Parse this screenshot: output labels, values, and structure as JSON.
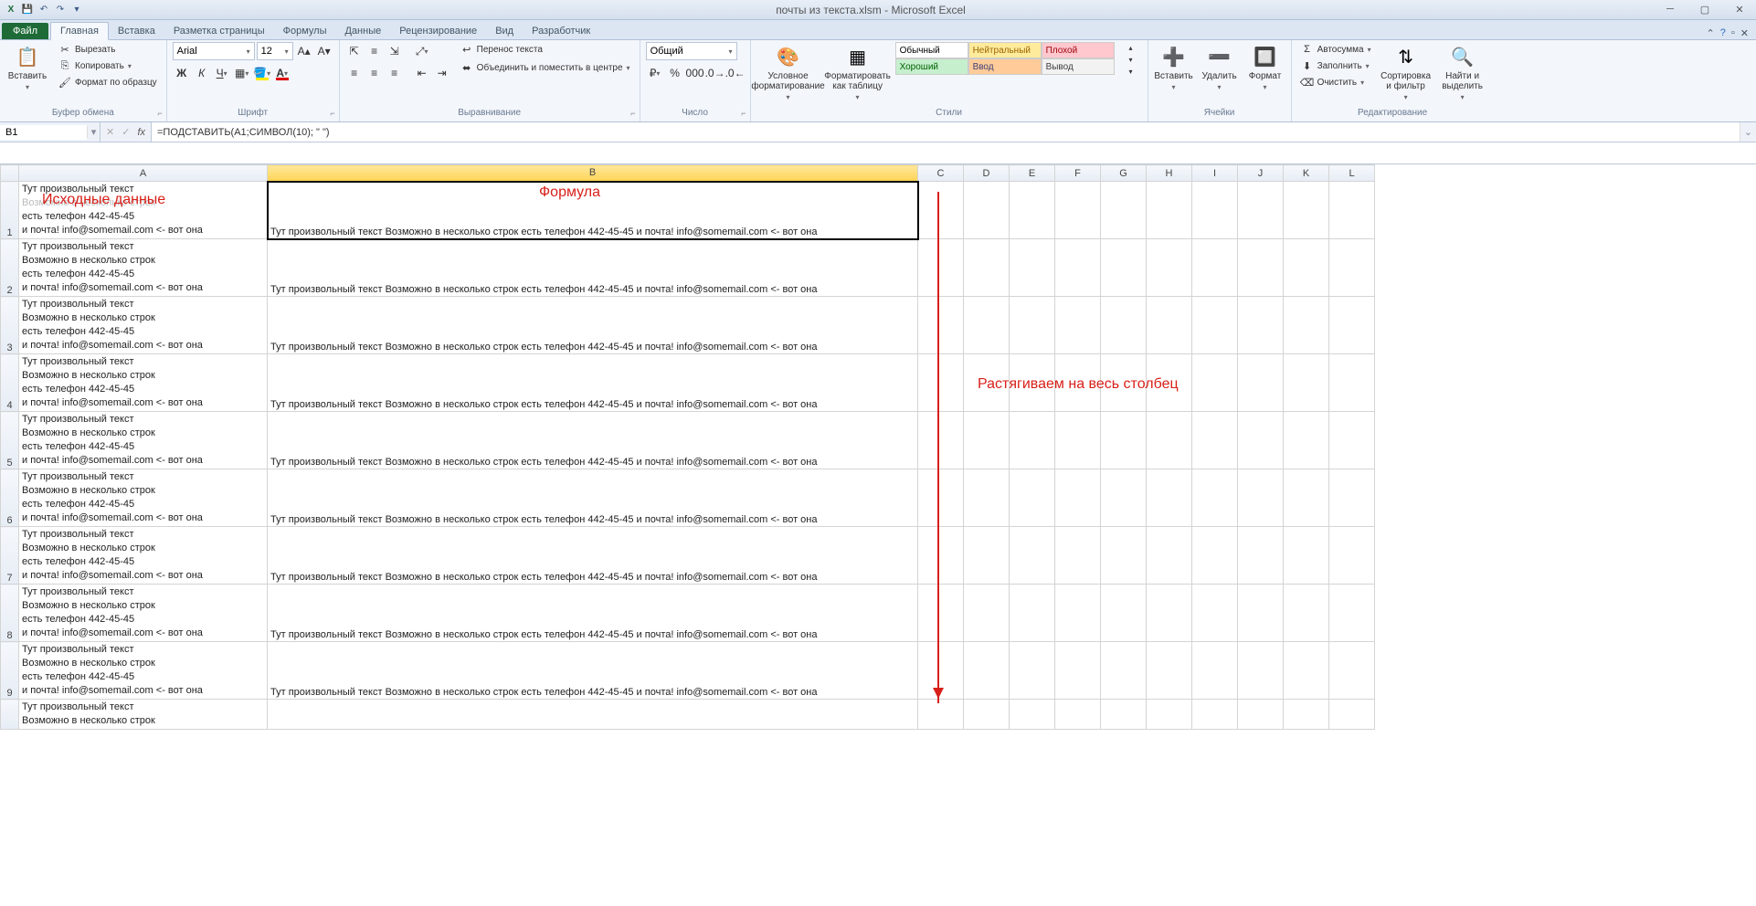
{
  "title": "почты из текста.xlsm - Microsoft Excel",
  "qat": {
    "save": "💾",
    "undo": "↶",
    "redo": "↷"
  },
  "tabs": {
    "file": "Файл",
    "items": [
      "Главная",
      "Вставка",
      "Разметка страницы",
      "Формулы",
      "Данные",
      "Рецензирование",
      "Вид",
      "Разработчик"
    ],
    "active": 0
  },
  "ribbon": {
    "paste": "Вставить",
    "cut": "Вырезать",
    "copy": "Копировать",
    "fmtpaint": "Формат по образцу",
    "clipboard": "Буфер обмена",
    "font": "Шрифт",
    "fontname": "Arial",
    "fontsize": "12",
    "align": "Выравнивание",
    "wrap": "Перенос текста",
    "merge": "Объединить и поместить в центре",
    "number": "Число",
    "numfmt": "Общий",
    "condfmt": "Условное форматирование",
    "fmttable": "Форматировать как таблицу",
    "styles": "Стили",
    "style_list": [
      "Обычный",
      "Нейтральный",
      "Плохой",
      "Хороший",
      "Ввод",
      "Вывод"
    ],
    "cells": "Ячейки",
    "insert": "Вставить",
    "delete": "Удалить",
    "format": "Формат",
    "editing": "Редактирование",
    "autosum": "Автосумма",
    "fill": "Заполнить",
    "clear": "Очистить",
    "sort": "Сортировка и фильтр",
    "find": "Найти и выделить"
  },
  "namebox": "B1",
  "formula": "=ПОДСТАВИТЬ(A1;СИМВОЛ(10); \" \")",
  "columns": [
    "A",
    "B",
    "C",
    "D",
    "E",
    "F",
    "G",
    "H",
    "I",
    "J",
    "K",
    "L"
  ],
  "cell_a": "Тут произвольный текст\nВозможно в несколько строк\nесть телефон 442-45-45\nи почта! info@somemail.com <- вот она",
  "cell_a_ghost": "Возможно в несколько строк",
  "cell_b": "Тут произвольный текст Возможно в несколько строк есть телефон 442-45-45 и почта! info@somemail.com <- вот она",
  "row_cut": "Тут произвольный текст\nВозможно в несколько строк",
  "rows": 9,
  "anno": {
    "src": "Исходные данные",
    "frm": "Формула",
    "stretch": "Растягиваем на весь столбец"
  }
}
